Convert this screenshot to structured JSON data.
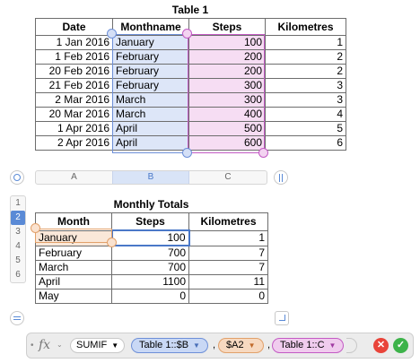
{
  "table1": {
    "title": "Table 1",
    "headers": [
      "Date",
      "Monthname",
      "Steps",
      "Kilometres"
    ],
    "rows": [
      [
        "1 Jan 2016",
        "January",
        "100",
        "1"
      ],
      [
        "1 Feb 2016",
        "February",
        "200",
        "2"
      ],
      [
        "20 Feb 2016",
        "February",
        "200",
        "2"
      ],
      [
        "21 Feb 2016",
        "February",
        "300",
        "3"
      ],
      [
        "2 Mar 2016",
        "March",
        "300",
        "3"
      ],
      [
        "20 Mar 2016",
        "March",
        "400",
        "4"
      ],
      [
        "1 Apr 2016",
        "April",
        "500",
        "5"
      ],
      [
        "2 Apr 2016",
        "April",
        "600",
        "6"
      ]
    ]
  },
  "column_bar": {
    "labels": [
      "A",
      "B",
      "C"
    ],
    "active": "B"
  },
  "row_bar": {
    "labels": [
      "1",
      "2",
      "3",
      "4",
      "5",
      "6"
    ],
    "active": "2"
  },
  "monthly_totals": {
    "title": "Monthly Totals",
    "headers": [
      "Month",
      "Steps",
      "Kilometres"
    ],
    "rows": [
      [
        "January",
        "100",
        "1"
      ],
      [
        "February",
        "700",
        "7"
      ],
      [
        "March",
        "700",
        "7"
      ],
      [
        "April",
        "1100",
        "11"
      ],
      [
        "May",
        "0",
        "0"
      ]
    ]
  },
  "formula_bar": {
    "fx_label": "fx",
    "function_name": "SUMIF",
    "tokens": [
      "Table 1::$B",
      "$A2",
      "Table 1::C"
    ],
    "separator": ",",
    "token_colors": {
      "blue": "#c9d8f5",
      "orange": "#f7d9c0",
      "pink": "#f0ccee"
    },
    "cancel_glyph": "✕",
    "accept_glyph": "✓",
    "cancel_color": "#e9443a",
    "accept_color": "#3db34a"
  }
}
